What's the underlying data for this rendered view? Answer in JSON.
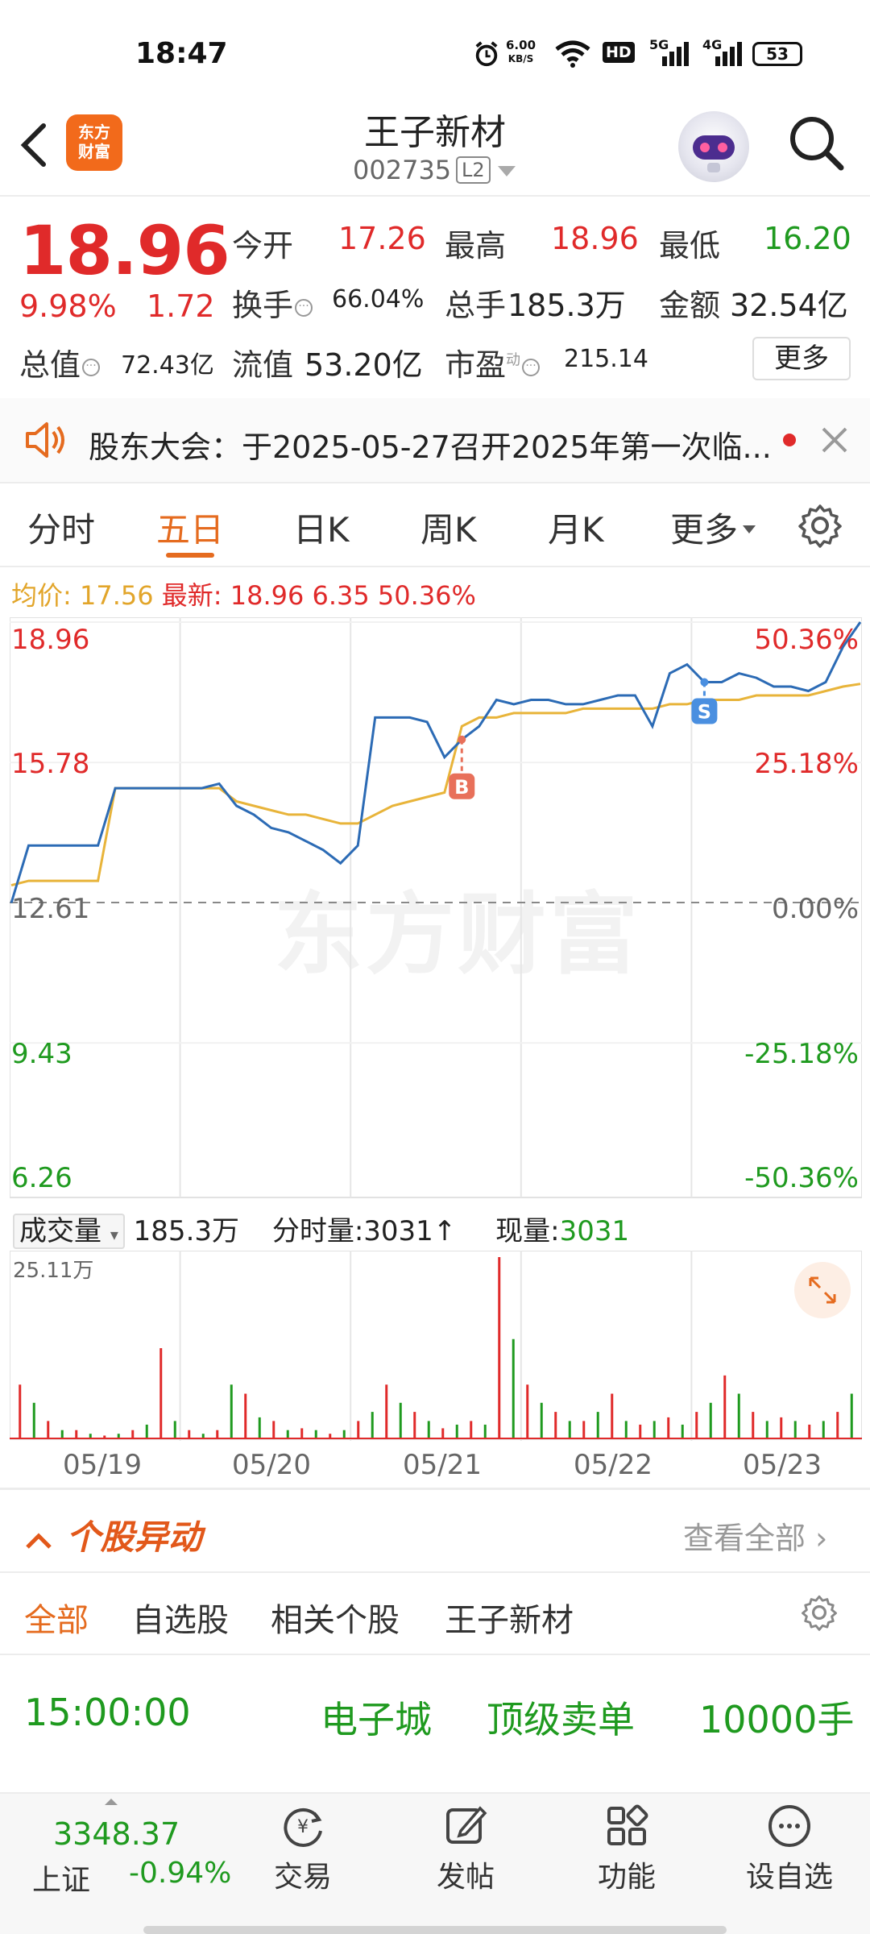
{
  "status_bar": {
    "time": "18:47",
    "net_speed_value": "6.00",
    "net_speed_unit": "KB/S",
    "hd": "HD",
    "sig5g": "5G",
    "sig4g": "4G",
    "battery": "53"
  },
  "header": {
    "logo_text_1": "东方",
    "logo_text_2": "财富",
    "stock_name": "王子新材",
    "stock_code": "002735",
    "level_badge": "L2"
  },
  "quote": {
    "last_price": "18.96",
    "change_pct": "9.98%",
    "change_amt": "1.72",
    "open_label": "今开",
    "open": "17.26",
    "high_label": "最高",
    "high": "18.96",
    "low_label": "最低",
    "low": "16.20",
    "turnover_label": "换手",
    "turnover": "66.04%",
    "volume_label": "总手",
    "volume": "185.3万",
    "amount_label": "金额",
    "amount": "32.54亿",
    "mktcap_label": "总值",
    "mktcap": "72.43亿",
    "float_label": "流值",
    "float_cap": "53.20亿",
    "pe_label": "市盈",
    "pe_sup": "动",
    "pe": "215.14",
    "more_label": "更多"
  },
  "announcement": {
    "text": "股东大会：于2025-05-27召开2025年第一次临..."
  },
  "tabs": [
    "分时",
    "五日",
    "日K",
    "周K",
    "月K",
    "更多"
  ],
  "active_tab": "五日",
  "avg_row": {
    "avg_label": "均价:",
    "avg_value": "17.56",
    "last_label": "最新:",
    "last_value": "18.96",
    "chg": "6.35",
    "pct": "50.36%"
  },
  "chart_data": {
    "type": "line",
    "days": [
      "05/19",
      "05/20",
      "05/21",
      "05/22",
      "05/23"
    ],
    "y_left_ticks": [
      "18.96",
      "15.78",
      "12.61",
      "9.43",
      "6.26"
    ],
    "y_right_ticks": [
      "50.36%",
      "25.18%",
      "0.00%",
      "-25.18%",
      "-50.36%"
    ],
    "ylim": [
      6.26,
      18.96
    ],
    "prev_close": 12.61,
    "series": [
      {
        "name": "价格",
        "color": "#2c6bb5",
        "values": [
          12.6,
          13.9,
          13.9,
          13.9,
          13.9,
          13.9,
          15.2,
          15.2,
          15.2,
          15.2,
          15.2,
          15.2,
          15.3,
          14.8,
          14.6,
          14.3,
          14.2,
          14.0,
          13.8,
          13.5,
          13.9,
          16.8,
          16.8,
          16.8,
          16.7,
          15.9,
          16.3,
          16.6,
          17.2,
          17.1,
          17.2,
          17.2,
          17.1,
          17.1,
          17.2,
          17.3,
          17.3,
          16.6,
          17.8,
          18.0,
          17.6,
          17.6,
          17.8,
          17.7,
          17.5,
          17.5,
          17.4,
          17.6,
          18.4,
          18.96
        ]
      },
      {
        "name": "均价",
        "color": "#e8b43a",
        "values": [
          13.0,
          13.1,
          13.1,
          13.1,
          13.1,
          13.1,
          15.2,
          15.2,
          15.2,
          15.2,
          15.2,
          15.2,
          15.2,
          14.9,
          14.8,
          14.7,
          14.6,
          14.6,
          14.5,
          14.4,
          14.4,
          14.6,
          14.8,
          14.9,
          15.0,
          15.1,
          16.6,
          16.8,
          16.8,
          16.9,
          16.9,
          16.9,
          16.9,
          17.0,
          17.0,
          17.0,
          17.0,
          17.0,
          17.1,
          17.1,
          17.2,
          17.2,
          17.2,
          17.3,
          17.3,
          17.3,
          17.3,
          17.4,
          17.5,
          17.56
        ]
      }
    ],
    "markers": [
      {
        "label": "B",
        "color": "#e8705a"
      },
      {
        "label": "S",
        "color": "#4a8fe0"
      }
    ],
    "watermark": "东方财富"
  },
  "volume_row": {
    "selector": "成交量",
    "total": "185.3万",
    "tick_label": "分时量:3031",
    "tick_arrow": "↑",
    "current_label": "现量:",
    "current": "3031",
    "max_label": "25.11万"
  },
  "volume_data": {
    "type": "bar",
    "values": [
      0.3,
      0.2,
      0.1,
      0.05,
      0.05,
      0.03,
      0.02,
      0.03,
      0.05,
      0.08,
      0.5,
      0.1,
      0.05,
      0.03,
      0.05,
      0.3,
      0.25,
      0.12,
      0.1,
      0.05,
      0.06,
      0.05,
      0.03,
      0.05,
      0.1,
      0.15,
      0.3,
      0.2,
      0.15,
      0.1,
      0.06,
      0.08,
      0.1,
      0.08,
      1.0,
      0.55,
      0.3,
      0.2,
      0.15,
      0.1,
      0.1,
      0.15,
      0.25,
      0.1,
      0.08,
      0.1,
      0.12,
      0.08,
      0.15,
      0.2,
      0.35,
      0.25,
      0.15,
      0.1,
      0.12,
      0.1,
      0.08,
      0.1,
      0.15,
      0.25
    ]
  },
  "movement": {
    "title": "个股异动",
    "view_all": "查看全部",
    "filters": [
      "全部",
      "自选股",
      "相关个股",
      "王子新材"
    ],
    "active_filter": "全部",
    "rows": [
      {
        "time": "15:00:00",
        "plate": "电子城",
        "type": "顶级卖单",
        "qty": "10000手"
      }
    ]
  },
  "bottom_nav": {
    "index_value": "3348.37",
    "index_name": "上证",
    "index_change": "-0.94%",
    "items": [
      "交易",
      "发帖",
      "功能",
      "设自选"
    ]
  }
}
